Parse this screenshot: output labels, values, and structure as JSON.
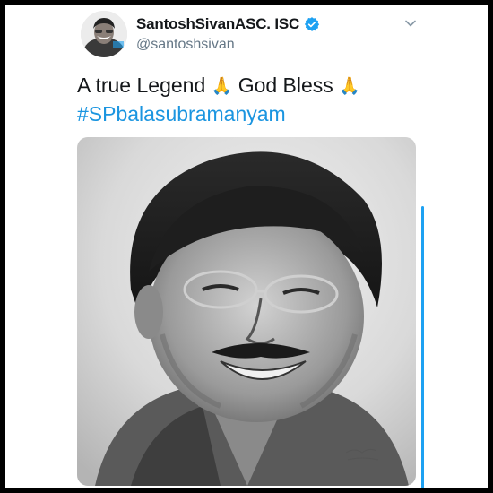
{
  "tweet": {
    "author": {
      "display_name": "SantoshSivanASC. ISC",
      "handle": "@santoshsivan",
      "verified": true,
      "avatar_icon": "profile-photo"
    },
    "text_line1_a": "A true Legend",
    "emoji_1": "🙏",
    "text_line1_b": "God Bless",
    "emoji_2": "🙏",
    "hashtag": "#SPbalasubramanyam",
    "media": {
      "type": "pencil-sketch-portrait"
    },
    "menu_icon": "chevron-down-icon"
  },
  "colors": {
    "accent": "#1da1f2",
    "hashtag": "#1b95e0",
    "text_primary": "#14171a",
    "text_secondary": "#657786"
  }
}
